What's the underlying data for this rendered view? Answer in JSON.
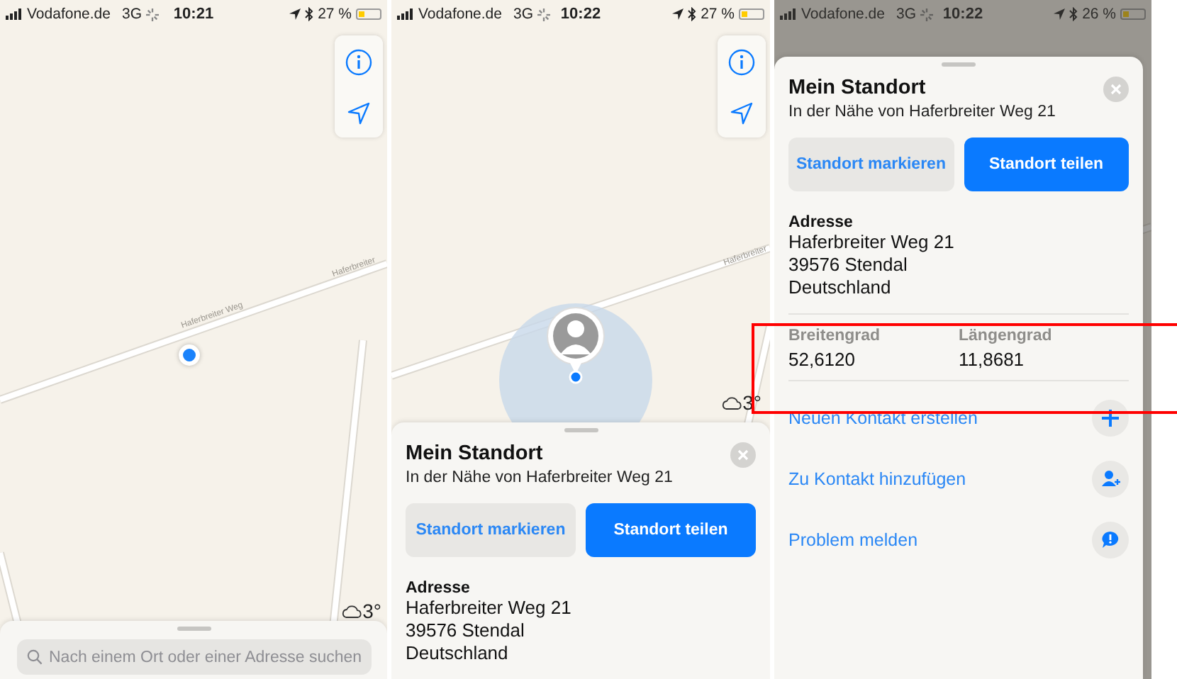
{
  "screens": [
    {
      "kind": "search",
      "dimmed": false,
      "status_bar": {
        "carrier": "Vodafone.de",
        "network": "3G",
        "time": "10:21",
        "battery": "27 %"
      },
      "map": {
        "road_labels": [
          "Haferbreiter Weg",
          "Haferbreiter"
        ],
        "kind": "dot",
        "weather": "3°"
      },
      "search": {
        "placeholder": "Nach einem Ort oder einer Adresse suchen"
      }
    },
    {
      "kind": "place",
      "dimmed": false,
      "status_bar": {
        "carrier": "Vodafone.de",
        "network": "3G",
        "time": "10:22",
        "battery": "27 %"
      },
      "map": {
        "road_labels": [
          "Haferbreiter"
        ],
        "kind": "avatar",
        "weather": "3°"
      },
      "sheet": {
        "title": "Mein Standort",
        "subtitle": "In der Nähe von Haferbreiter Weg 21",
        "buttons": [
          {
            "label": "Standort markieren",
            "kind": "secondary"
          },
          {
            "label": "Standort teilen",
            "kind": "primary"
          }
        ],
        "address": {
          "label": "Adresse",
          "lines": [
            "Haferbreiter Weg 21",
            "39576 Stendal",
            "Deutschland"
          ]
        }
      }
    },
    {
      "kind": "place",
      "dimmed": true,
      "status_bar": {
        "carrier": "Vodafone.de",
        "network": "3G",
        "time": "10:22",
        "battery": "26 %"
      },
      "sheet": {
        "title": "Mein Standort",
        "subtitle": "In der Nähe von Haferbreiter Weg 21",
        "buttons": [
          {
            "label": "Standort markieren",
            "kind": "secondary"
          },
          {
            "label": "Standort teilen",
            "kind": "primary"
          }
        ],
        "address": {
          "label": "Adresse",
          "lines": [
            "Haferbreiter Weg 21",
            "39576 Stendal",
            "Deutschland"
          ]
        },
        "coordinates": [
          {
            "label": "Breitengrad",
            "value": "52,6120"
          },
          {
            "label": "Längengrad",
            "value": "11,8681"
          }
        ],
        "actions": [
          {
            "label": "Neuen Kontakt erstellen",
            "kind": "add"
          },
          {
            "label": "Zu Kontakt hinzufügen",
            "kind": "add_person"
          },
          {
            "label": "Problem melden",
            "kind": "report"
          }
        ]
      }
    }
  ]
}
